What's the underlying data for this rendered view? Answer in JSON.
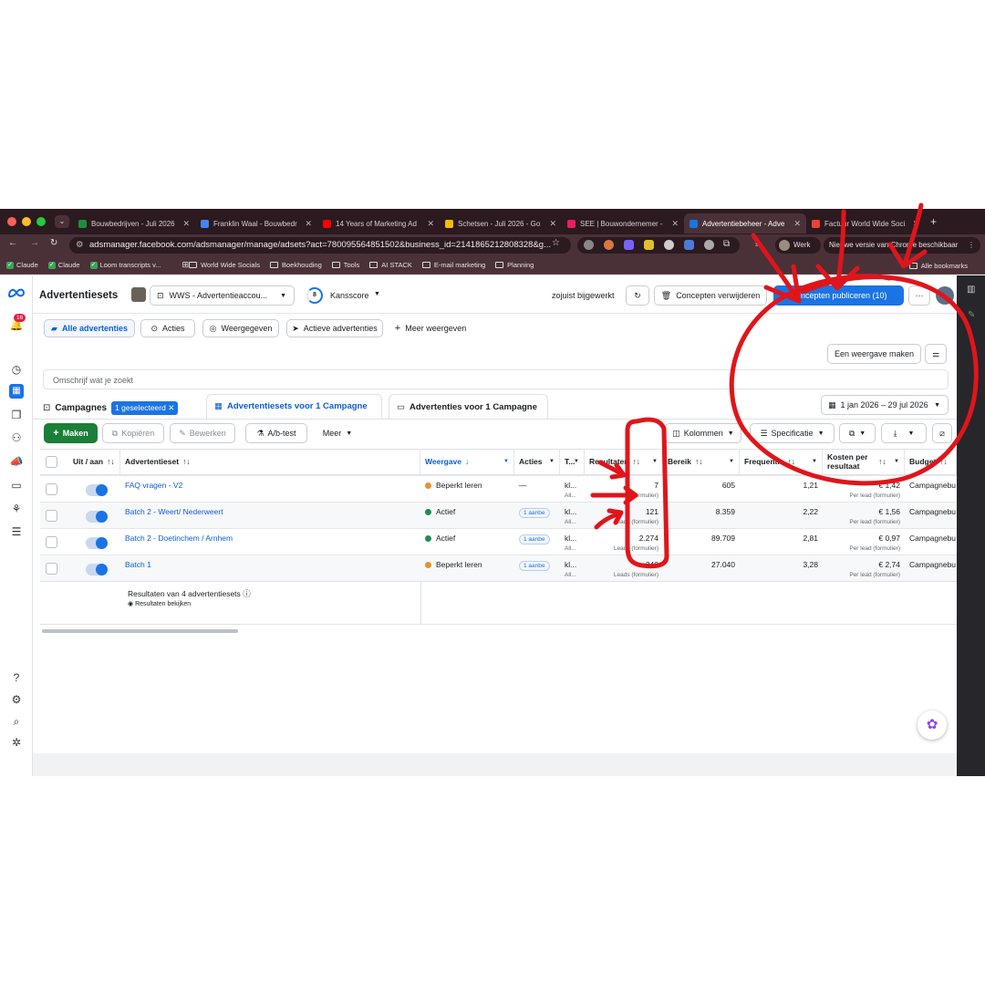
{
  "browser": {
    "tabs": [
      {
        "title": "Bouwbedrijven - Juli 2026",
        "color": "#1e8e3e"
      },
      {
        "title": "Franklin Waal - Bouwbedr",
        "color": "#4285f4"
      },
      {
        "title": "14 Years of Marketing Ad",
        "color": "#ff0000"
      },
      {
        "title": "Schetsen - Juli 2026 - Go",
        "color": "#fbbc04"
      },
      {
        "title": "SEE | Bouwondernemer -",
        "color": "#e91e63"
      },
      {
        "title": "Advertentiebeheer - Adve",
        "color": "#1b74e4"
      },
      {
        "title": "Factuur World Wide Soci",
        "color": "#ea4335"
      }
    ],
    "url": "adsmanager.facebook.com/adsmanager/manage/adsets?act=780095564851502&business_id=2141865212808328&g...",
    "profile_label": "Werk",
    "update_notice": "Nieuwe versie van Chrome beschikbaar",
    "bookmarks": [
      {
        "label": "Claude",
        "kind": "check"
      },
      {
        "label": "Claude",
        "kind": "check"
      },
      {
        "label": "Loom transcripts v...",
        "kind": "check"
      },
      {
        "label": "World Wide Socials",
        "kind": "folder"
      },
      {
        "label": "Boekhouding",
        "kind": "folder"
      },
      {
        "label": "Tools",
        "kind": "folder"
      },
      {
        "label": "AI STACK",
        "kind": "folder"
      },
      {
        "label": "E-mail marketing",
        "kind": "folder"
      },
      {
        "label": "Planning",
        "kind": "folder"
      }
    ],
    "all_bookmarks": "Alle bookmarks"
  },
  "header": {
    "title": "Advertentiesets",
    "account": "WWS - Advertentieaccou...",
    "score_value": "8",
    "score_label": "Kansscore",
    "updated": "zojuist bijgewerkt",
    "delete_drafts": "Concepten verwijderen",
    "publish": "Concepten publiceren (10)",
    "more": "···",
    "notif_count": "16"
  },
  "views": {
    "items": [
      "Alle advertenties",
      "Acties",
      "Weergegeven",
      "Actieve advertenties"
    ],
    "more": "Meer weergeven",
    "make_view": "Een weergave maken"
  },
  "search": {
    "placeholder": "Omschrijf wat je zoekt"
  },
  "level_tabs": {
    "campaigns": "Campagnes",
    "selected": "1 geselecteerd",
    "adsets": "Advertentiesets voor 1 Campagne",
    "ads": "Advertenties voor 1 Campagne"
  },
  "date_range": "1 jan 2026 – 29 jul 2026",
  "toolbar": {
    "create": "Maken",
    "copy": "Kopiëren",
    "edit": "Bewerken",
    "ab": "A/b-test",
    "more": "Meer",
    "columns": "Kolommen",
    "breakdown": "Specificatie"
  },
  "columns": [
    "Uit / aan",
    "Advertentieset",
    "Weergave",
    "Acties",
    "T...",
    "Resultaten",
    "Bereik",
    "Frequentie",
    "Kosten per resultaat",
    "Budget"
  ],
  "rows": [
    {
      "name": "FAQ vragen - V2",
      "status": "Beperkt leren",
      "status_color": "#e8912d",
      "actions": "—",
      "type": "kl...",
      "type_sub": "All...",
      "results": "7",
      "results_sub": "Leads (formulier)",
      "reach": "605",
      "frequency": "1,21",
      "cost": "€ 1,42",
      "cost_sub": "Per lead (formulier)",
      "budget": "Campagnebu"
    },
    {
      "name": "Batch 2 - Weert/ Nederweert",
      "status": "Actief",
      "status_color": "#1a8f53",
      "actions": "1 aanbe",
      "type": "kl...",
      "type_sub": "All...",
      "results": "121",
      "results_sub": "Leads (formulier)",
      "reach": "8.359",
      "frequency": "2,22",
      "cost": "€ 1,56",
      "cost_sub": "Per lead (formulier)",
      "budget": "Campagnebu"
    },
    {
      "name": "Batch 2 - Doetinchem / Arnhem",
      "status": "Actief",
      "status_color": "#1a8f53",
      "actions": "1 aanbe",
      "type": "kl...",
      "type_sub": "All...",
      "results": "2.274",
      "results_sub": "Leads (formulier)",
      "reach": "89.709",
      "frequency": "2,81",
      "cost": "€ 0,97",
      "cost_sub": "Per lead (formulier)",
      "budget": "Campagnebu"
    },
    {
      "name": "Batch 1",
      "status": "Beperkt leren",
      "status_color": "#e8912d",
      "actions": "1 aanbe",
      "type": "kl...",
      "type_sub": "All...",
      "results": "340",
      "results_sub": "Leads (formulier)",
      "reach": "27.040",
      "frequency": "3,28",
      "cost": "€ 2,74",
      "cost_sub": "Per lead (formulier)",
      "budget": "Campagnebu"
    }
  ],
  "summary": {
    "text": "Resultaten van 4 advertentiesets",
    "link": "Resultaten bekijken"
  },
  "colors": {
    "accent": "#1b74e4",
    "primary_green": "#1a7f37",
    "annotation": "#e0151b"
  }
}
